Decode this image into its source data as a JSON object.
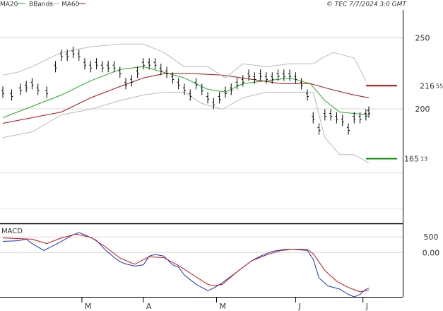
{
  "legend": {
    "ma20_label": "MA20",
    "bbands_label": "BBands",
    "ma60_label": "MA60",
    "ma20_color": "#22aa22",
    "bbands_color": "#bbbbbb",
    "ma60_color": "#aa1111"
  },
  "watermark": "© TEC 7/7/2024 3:0 GMT",
  "chart_data": [
    {
      "type": "line",
      "panel": "price",
      "ylim": [
        120,
        270
      ],
      "y_ticks": [
        {
          "value": 250,
          "label": "250"
        },
        {
          "value": 200,
          "label": "200"
        }
      ],
      "x_ticks": [
        {
          "index": 27,
          "label": "M"
        },
        {
          "index": 48,
          "label": "A"
        },
        {
          "index": 73,
          "label": "M"
        },
        {
          "index": 100,
          "label": "J"
        },
        {
          "index": 123,
          "label": "J"
        }
      ],
      "levels": [
        {
          "name": "resistance",
          "value": 216.55,
          "int": "216",
          "dec": "55",
          "color": "#cc0000"
        },
        {
          "name": "support",
          "value": 165.13,
          "int": "165",
          "dec": "13",
          "color": "#008800"
        }
      ],
      "series": [
        {
          "name": "MA20",
          "color": "#22aa22",
          "points": [
            [
              0,
              194
            ],
            [
              10,
              202
            ],
            [
              20,
              210
            ],
            [
              30,
              220
            ],
            [
              40,
              228
            ],
            [
              48,
              230
            ],
            [
              55,
              226
            ],
            [
              62,
              222
            ],
            [
              70,
              214
            ],
            [
              76,
              212
            ],
            [
              82,
              218
            ],
            [
              90,
              220
            ],
            [
              98,
              222
            ],
            [
              105,
              218
            ],
            [
              110,
              206
            ],
            [
              115,
              198
            ],
            [
              125,
              196
            ]
          ]
        },
        {
          "name": "MA60",
          "color": "#aa1111",
          "points": [
            [
              0,
              190
            ],
            [
              10,
              194
            ],
            [
              20,
              198
            ],
            [
              30,
              208
            ],
            [
              40,
              216
            ],
            [
              48,
              222
            ],
            [
              55,
              225
            ],
            [
              65,
              225
            ],
            [
              75,
              224
            ],
            [
              85,
              221
            ],
            [
              95,
              218
            ],
            [
              105,
              218
            ],
            [
              112,
              214
            ],
            [
              120,
              210
            ],
            [
              125,
              208
            ]
          ]
        },
        {
          "name": "BBands upper",
          "color": "#bbbbbb",
          "points": [
            [
              0,
              224
            ],
            [
              5,
              226
            ],
            [
              10,
              230
            ],
            [
              20,
              240
            ],
            [
              30,
              244
            ],
            [
              40,
              246
            ],
            [
              48,
              246
            ],
            [
              55,
              240
            ],
            [
              62,
              230
            ],
            [
              70,
              230
            ],
            [
              76,
              222
            ],
            [
              82,
              232
            ],
            [
              90,
              230
            ],
            [
              98,
              232
            ],
            [
              106,
              232
            ],
            [
              109,
              236
            ],
            [
              113,
              240
            ],
            [
              120,
              236
            ],
            [
              124,
              220
            ]
          ]
        },
        {
          "name": "BBands lower",
          "color": "#bbbbbb",
          "points": [
            [
              0,
              180
            ],
            [
              5,
              182
            ],
            [
              10,
              184
            ],
            [
              20,
              196
            ],
            [
              30,
              200
            ],
            [
              40,
              206
            ],
            [
              48,
              210
            ],
            [
              55,
              212
            ],
            [
              62,
              212
            ],
            [
              68,
              204
            ],
            [
              75,
              200
            ],
            [
              82,
              208
            ],
            [
              90,
              212
            ],
            [
              98,
              212
            ],
            [
              106,
              212
            ],
            [
              110,
              180
            ],
            [
              115,
              168
            ],
            [
              120,
              168
            ],
            [
              125,
              162
            ]
          ]
        },
        {
          "name": "Price",
          "color": "#000000",
          "type": "ohlc-approx",
          "points": [
            [
              0,
              212
            ],
            [
              3,
              210
            ],
            [
              6,
              214
            ],
            [
              8,
              216
            ],
            [
              10,
              218
            ],
            [
              12,
              214
            ],
            [
              15,
              212
            ],
            [
              18,
              230
            ],
            [
              20,
              238
            ],
            [
              22,
              238
            ],
            [
              24,
              240
            ],
            [
              26,
              238
            ],
            [
              28,
              232
            ],
            [
              30,
              230
            ],
            [
              32,
              232
            ],
            [
              34,
              230
            ],
            [
              36,
              230
            ],
            [
              38,
              230
            ],
            [
              40,
              226
            ],
            [
              42,
              218
            ],
            [
              44,
              220
            ],
            [
              46,
              226
            ],
            [
              48,
              232
            ],
            [
              50,
              232
            ],
            [
              52,
              232
            ],
            [
              54,
              228
            ],
            [
              56,
              226
            ],
            [
              58,
              222
            ],
            [
              60,
              218
            ],
            [
              62,
              214
            ],
            [
              64,
              210
            ],
            [
              66,
              218
            ],
            [
              68,
              214
            ],
            [
              70,
              208
            ],
            [
              72,
              204
            ],
            [
              74,
              208
            ],
            [
              76,
              212
            ],
            [
              78,
              214
            ],
            [
              80,
              218
            ],
            [
              82,
              220
            ],
            [
              84,
              224
            ],
            [
              86,
              222
            ],
            [
              88,
              224
            ],
            [
              90,
              222
            ],
            [
              92,
              222
            ],
            [
              94,
              224
            ],
            [
              96,
              224
            ],
            [
              98,
              224
            ],
            [
              100,
              222
            ],
            [
              102,
              218
            ],
            [
              104,
              210
            ],
            [
              106,
              194
            ],
            [
              108,
              186
            ],
            [
              110,
              196
            ],
            [
              112,
              196
            ],
            [
              114,
              194
            ],
            [
              116,
              192
            ],
            [
              118,
              186
            ],
            [
              120,
              194
            ],
            [
              122,
              194
            ],
            [
              124,
              196
            ],
            [
              125,
              198
            ]
          ]
        }
      ]
    },
    {
      "type": "line",
      "panel": "macd",
      "title": "MACD",
      "ylim": [
        -1400,
        900
      ],
      "y_ticks": [
        {
          "value": 500,
          "label": "500"
        },
        {
          "value": 0,
          "label": "0.00"
        }
      ],
      "series": [
        {
          "name": "MACD",
          "color": "#1133cc",
          "points": [
            [
              0,
              370
            ],
            [
              5,
              390
            ],
            [
              8,
              440
            ],
            [
              10,
              300
            ],
            [
              14,
              80
            ],
            [
              18,
              270
            ],
            [
              20,
              370
            ],
            [
              24,
              580
            ],
            [
              26,
              650
            ],
            [
              28,
              580
            ],
            [
              32,
              400
            ],
            [
              35,
              100
            ],
            [
              38,
              -140
            ],
            [
              40,
              -280
            ],
            [
              42,
              -350
            ],
            [
              45,
              -420
            ],
            [
              48,
              -380
            ],
            [
              50,
              -100
            ],
            [
              52,
              -50
            ],
            [
              55,
              -100
            ],
            [
              58,
              -380
            ],
            [
              60,
              -450
            ],
            [
              62,
              -700
            ],
            [
              66,
              -1000
            ],
            [
              70,
              -1200
            ],
            [
              72,
              -1120
            ],
            [
              75,
              -950
            ],
            [
              80,
              -600
            ],
            [
              85,
              -250
            ],
            [
              88,
              -100
            ],
            [
              92,
              50
            ],
            [
              96,
              110
            ],
            [
              100,
              110
            ],
            [
              104,
              80
            ],
            [
              106,
              -200
            ],
            [
              108,
              -800
            ],
            [
              111,
              -1050
            ],
            [
              115,
              -1150
            ],
            [
              118,
              -1320
            ],
            [
              120,
              -1400
            ],
            [
              122,
              -1320
            ],
            [
              124,
              -1160
            ],
            [
              125,
              -1120
            ]
          ]
        },
        {
          "name": "Signal",
          "color": "#cc1111",
          "points": [
            [
              0,
              480
            ],
            [
              10,
              440
            ],
            [
              15,
              300
            ],
            [
              20,
              480
            ],
            [
              25,
              600
            ],
            [
              30,
              500
            ],
            [
              35,
              200
            ],
            [
              40,
              -160
            ],
            [
              45,
              -360
            ],
            [
              50,
              -120
            ],
            [
              55,
              -150
            ],
            [
              60,
              -400
            ],
            [
              65,
              -700
            ],
            [
              70,
              -1000
            ],
            [
              72,
              -1050
            ],
            [
              75,
              -1000
            ],
            [
              80,
              -600
            ],
            [
              85,
              -250
            ],
            [
              90,
              -60
            ],
            [
              95,
              80
            ],
            [
              100,
              120
            ],
            [
              104,
              110
            ],
            [
              106,
              -20
            ],
            [
              110,
              -560
            ],
            [
              114,
              -900
            ],
            [
              118,
              -1100
            ],
            [
              122,
              -1240
            ],
            [
              124,
              -1200
            ],
            [
              125,
              -1180
            ]
          ]
        }
      ]
    }
  ]
}
